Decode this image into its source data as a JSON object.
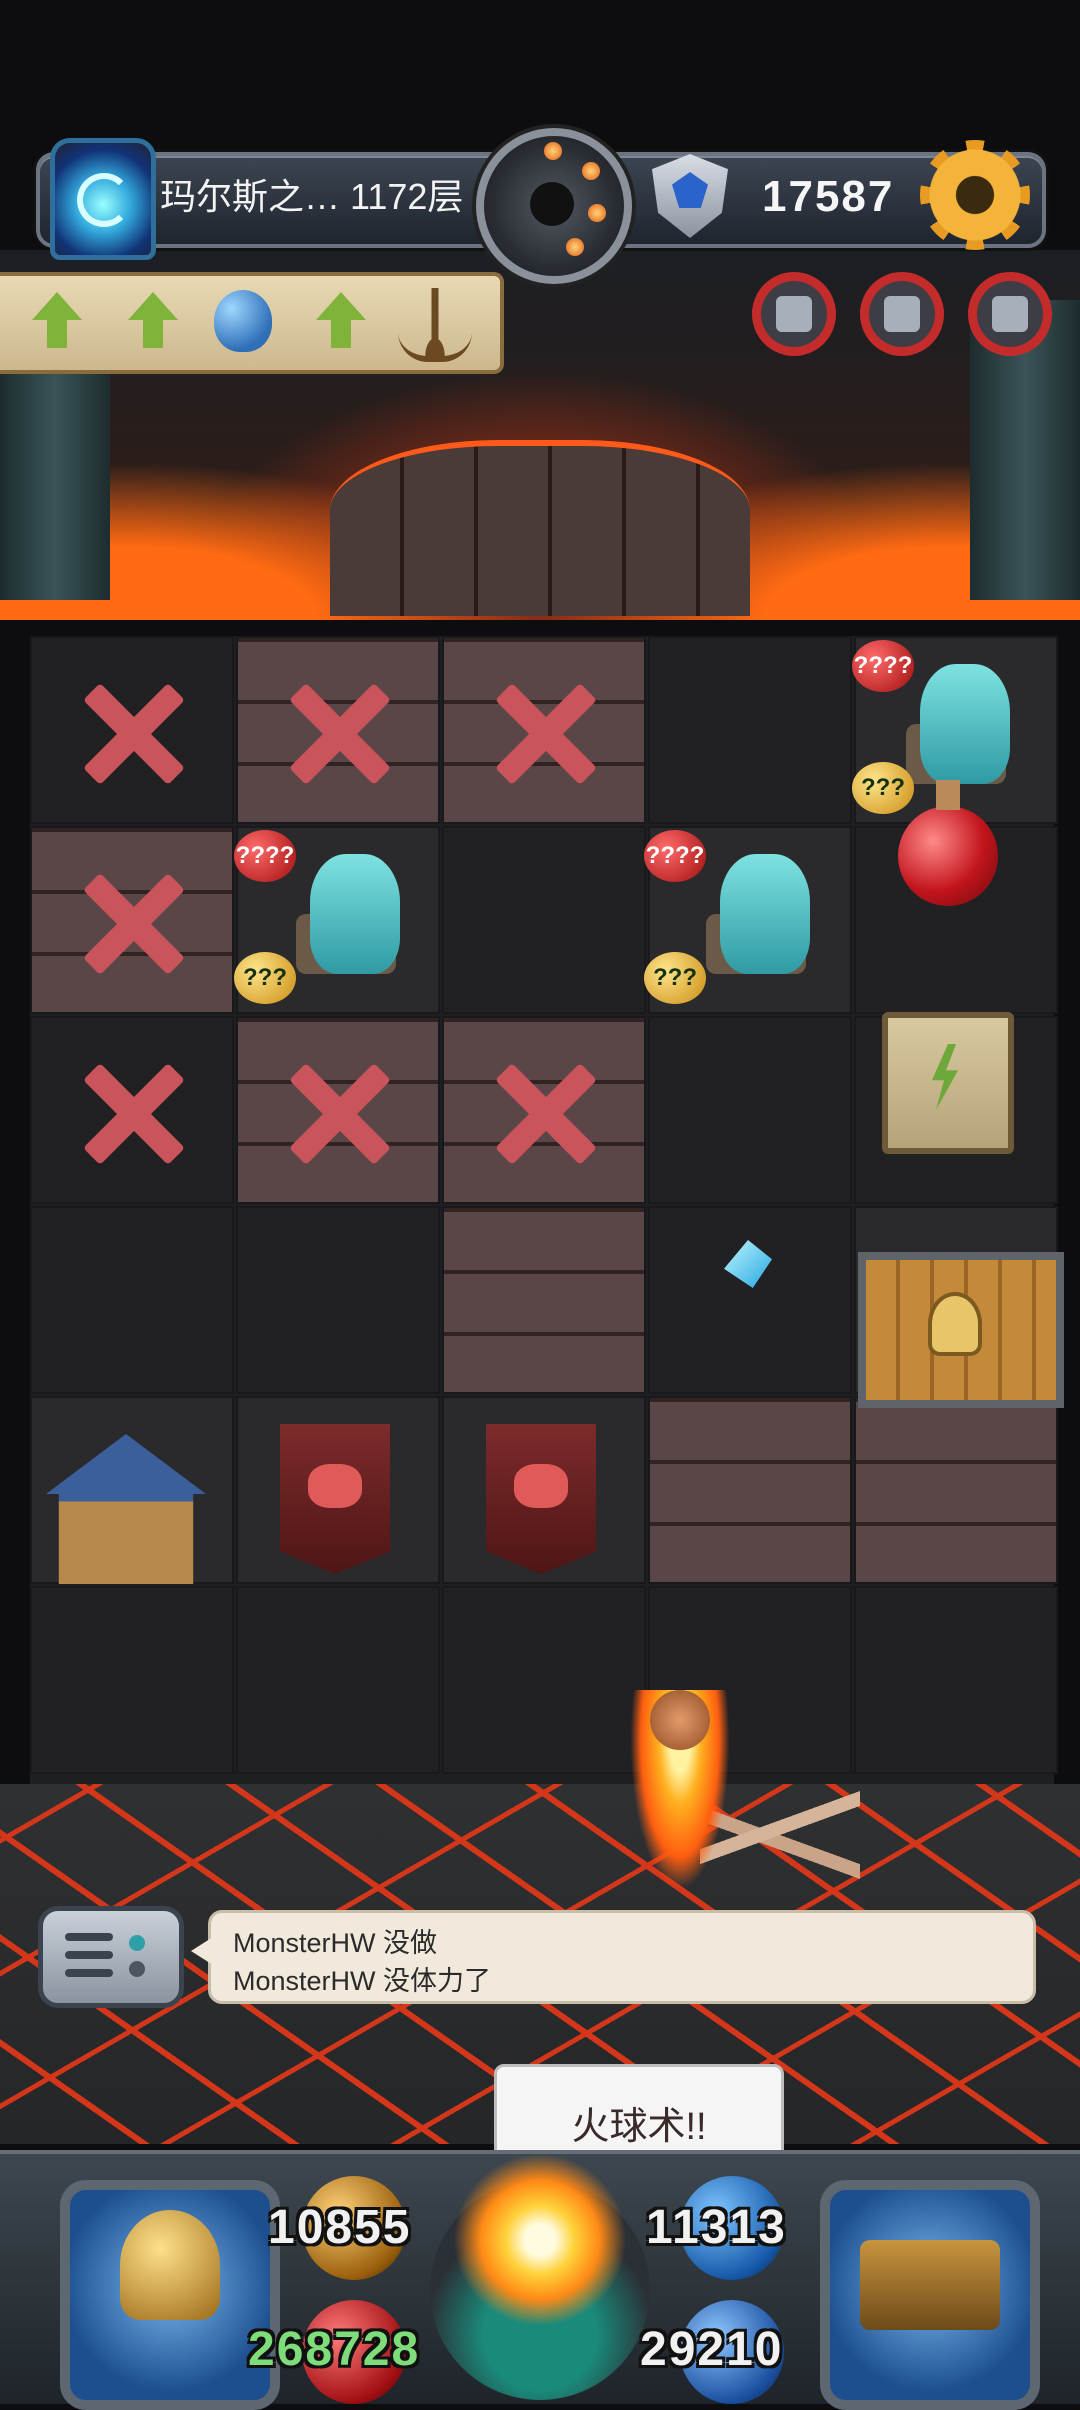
{
  "header": {
    "floor_label": "玛尔斯之… 1172层",
    "gold": "17587"
  },
  "grid": {
    "monster_1": {
      "attack": "????",
      "defense": "???"
    },
    "monster_2": {
      "attack": "????",
      "defense": "???"
    },
    "monster_3": {
      "attack": "????",
      "defense": "???"
    }
  },
  "chat": {
    "messages": [
      {
        "user": "MonsterHW",
        "text": "没做"
      },
      {
        "user": "MonsterHW",
        "text": "没体力了"
      }
    ],
    "line_1": "MonsterHW  没做",
    "line_2": "MonsterHW  没体力了"
  },
  "skill": {
    "callout": "火球术!!"
  },
  "hud": {
    "attack": "10855",
    "defense": "11313",
    "hp": "268728",
    "mp": "29210"
  },
  "colors": {
    "hp_text": "#7fdc7a",
    "stat_text": "#f1f1f1",
    "blocked_mark": "#c9545b",
    "lava": "#d4361a"
  },
  "icons": [
    "portal-icon",
    "bomb-icon",
    "shield-icon",
    "gear-icon",
    "arrow-up-icon",
    "egg-icon",
    "candelabra-icon",
    "potion-icon",
    "scroll-icon",
    "door-icon",
    "crystal-icon",
    "house-icon",
    "banner-icon"
  ]
}
